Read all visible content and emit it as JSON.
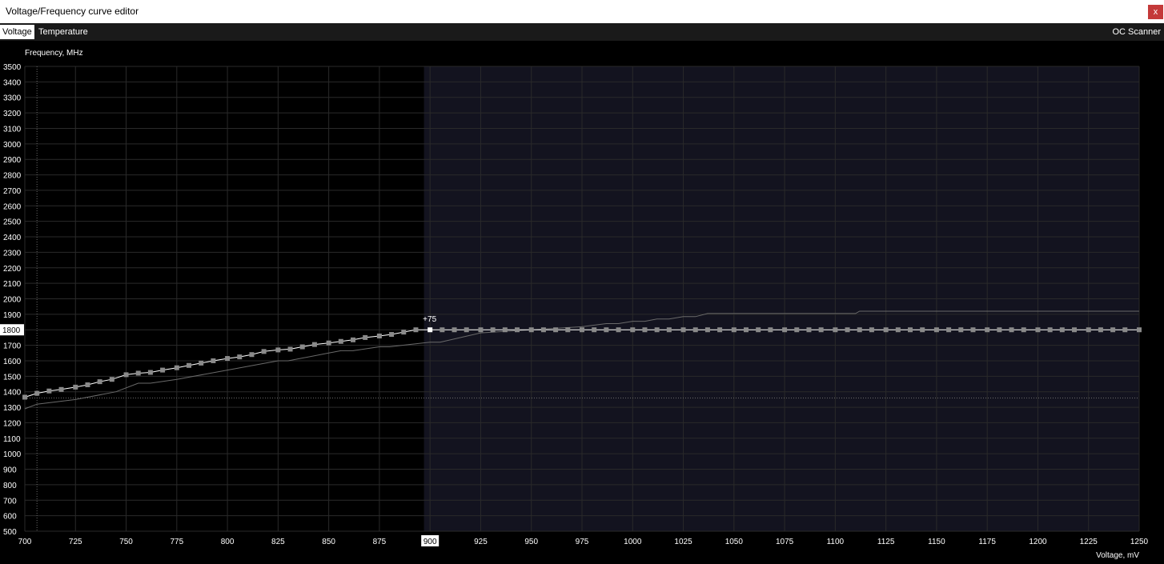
{
  "window": {
    "title": "Voltage/Frequency curve editor",
    "close_glyph": "x"
  },
  "tabs": [
    {
      "label": "Voltage",
      "active": true
    },
    {
      "label": "Temperature",
      "active": false
    }
  ],
  "oc_scanner_label": "OC Scanner",
  "chart_data": {
    "type": "line",
    "title": "",
    "ylabel": "Frequency, MHz",
    "xlabel": "Voltage, mV",
    "xlim": [
      700,
      1250
    ],
    "ylim": [
      500,
      3500
    ],
    "x_ticks": [
      700,
      725,
      750,
      775,
      800,
      825,
      850,
      875,
      900,
      925,
      950,
      975,
      1000,
      1025,
      1050,
      1075,
      1100,
      1125,
      1150,
      1175,
      1200,
      1225,
      1250
    ],
    "y_ticks": [
      500,
      600,
      700,
      800,
      900,
      1000,
      1100,
      1200,
      1300,
      1400,
      1500,
      1600,
      1700,
      1800,
      1900,
      2000,
      2100,
      2200,
      2300,
      2400,
      2500,
      2600,
      2700,
      2800,
      2900,
      3000,
      3100,
      3200,
      3300,
      3400,
      3500
    ],
    "grid": true,
    "selected_point": {
      "x": 900,
      "y": 1800,
      "x_label": "900",
      "y_label": "1800",
      "offset_label": "+75"
    },
    "reference_lines": {
      "voltage": 706,
      "frequency": 1360
    },
    "locked_region_start": 897,
    "series": [
      {
        "role": "curve",
        "points": [
          [
            700,
            1365
          ],
          [
            706,
            1390
          ],
          [
            712,
            1405
          ],
          [
            718,
            1415
          ],
          [
            725,
            1430
          ],
          [
            731,
            1445
          ],
          [
            737,
            1465
          ],
          [
            743,
            1480
          ],
          [
            750,
            1510
          ],
          [
            756,
            1520
          ],
          [
            762,
            1525
          ],
          [
            768,
            1540
          ],
          [
            775,
            1555
          ],
          [
            781,
            1570
          ],
          [
            787,
            1585
          ],
          [
            793,
            1600
          ],
          [
            800,
            1615
          ],
          [
            806,
            1625
          ],
          [
            812,
            1640
          ],
          [
            818,
            1660
          ],
          [
            825,
            1670
          ],
          [
            831,
            1675
          ],
          [
            837,
            1690
          ],
          [
            843,
            1705
          ],
          [
            850,
            1715
          ],
          [
            856,
            1725
          ],
          [
            862,
            1735
          ],
          [
            868,
            1750
          ],
          [
            875,
            1760
          ],
          [
            881,
            1770
          ],
          [
            887,
            1785
          ],
          [
            893,
            1800
          ],
          [
            900,
            1800
          ],
          [
            906,
            1800
          ],
          [
            912,
            1800
          ],
          [
            918,
            1800
          ],
          [
            925,
            1800
          ],
          [
            931,
            1800
          ],
          [
            937,
            1800
          ],
          [
            943,
            1800
          ],
          [
            950,
            1800
          ],
          [
            956,
            1800
          ],
          [
            962,
            1800
          ],
          [
            968,
            1800
          ],
          [
            975,
            1800
          ],
          [
            981,
            1800
          ],
          [
            987,
            1800
          ],
          [
            993,
            1800
          ],
          [
            1000,
            1800
          ],
          [
            1006,
            1800
          ],
          [
            1012,
            1800
          ],
          [
            1018,
            1800
          ],
          [
            1025,
            1800
          ],
          [
            1031,
            1800
          ],
          [
            1037,
            1800
          ],
          [
            1043,
            1800
          ],
          [
            1050,
            1800
          ],
          [
            1056,
            1800
          ],
          [
            1062,
            1800
          ],
          [
            1068,
            1800
          ],
          [
            1075,
            1800
          ],
          [
            1081,
            1800
          ],
          [
            1087,
            1800
          ],
          [
            1093,
            1800
          ],
          [
            1100,
            1800
          ],
          [
            1106,
            1800
          ],
          [
            1112,
            1800
          ],
          [
            1118,
            1800
          ],
          [
            1125,
            1800
          ],
          [
            1131,
            1800
          ],
          [
            1137,
            1800
          ],
          [
            1143,
            1800
          ],
          [
            1150,
            1800
          ],
          [
            1156,
            1800
          ],
          [
            1162,
            1800
          ],
          [
            1168,
            1800
          ],
          [
            1175,
            1800
          ],
          [
            1181,
            1800
          ],
          [
            1187,
            1800
          ],
          [
            1193,
            1800
          ],
          [
            1200,
            1800
          ],
          [
            1206,
            1800
          ],
          [
            1212,
            1800
          ],
          [
            1218,
            1800
          ],
          [
            1225,
            1800
          ],
          [
            1231,
            1800
          ],
          [
            1237,
            1800
          ],
          [
            1243,
            1800
          ],
          [
            1250,
            1800
          ]
        ]
      },
      {
        "role": "default-curve",
        "points": [
          [
            700,
            1290
          ],
          [
            706,
            1320
          ],
          [
            725,
            1350
          ],
          [
            745,
            1400
          ],
          [
            756,
            1455
          ],
          [
            762,
            1455
          ],
          [
            775,
            1480
          ],
          [
            800,
            1540
          ],
          [
            825,
            1600
          ],
          [
            830,
            1600
          ],
          [
            850,
            1650
          ],
          [
            856,
            1665
          ],
          [
            862,
            1665
          ],
          [
            875,
            1690
          ],
          [
            880,
            1690
          ],
          [
            900,
            1720
          ],
          [
            905,
            1720
          ],
          [
            925,
            1780
          ],
          [
            950,
            1800
          ],
          [
            975,
            1820
          ],
          [
            987,
            1840
          ],
          [
            993,
            1840
          ],
          [
            1000,
            1855
          ],
          [
            1006,
            1855
          ],
          [
            1012,
            1870
          ],
          [
            1018,
            1870
          ],
          [
            1025,
            1885
          ],
          [
            1031,
            1885
          ],
          [
            1037,
            1905
          ],
          [
            1110,
            1905
          ],
          [
            1112,
            1920
          ],
          [
            1250,
            1920
          ]
        ]
      }
    ]
  },
  "colors": {
    "background": "#000000",
    "locked_region": "#13131f",
    "grid": "#2a2a2a",
    "curve": "#ffffff",
    "point": "#8a8a8a",
    "selected_point": "#ffffff",
    "default_curve": "#6a6a6a",
    "reference_line": "#6a6a6a",
    "label_text": "#ffffff",
    "selected_label_bg": "#ffffff",
    "selected_label_text": "#000000",
    "close_button": "#c43a3a"
  }
}
